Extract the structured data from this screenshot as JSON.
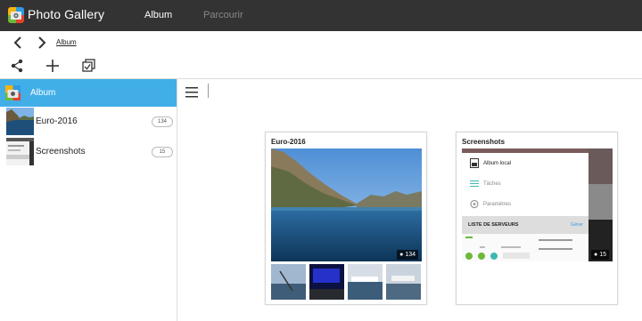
{
  "app": {
    "title": "Photo Gallery"
  },
  "nav": {
    "tab_album": "Album",
    "tab_browse": "Parcourir"
  },
  "breadcrumb": {
    "current": "Album"
  },
  "sidebar": {
    "header_label": "Album",
    "items": [
      {
        "label": "Euro-2016",
        "count": "134"
      },
      {
        "label": "Screenshots",
        "count": "15"
      }
    ]
  },
  "cards": [
    {
      "title": "Euro-2016",
      "count": "134"
    },
    {
      "title": "Screenshots",
      "count": "15",
      "preview": {
        "menu_items": [
          "Album local",
          "Tâches",
          "Paramètres"
        ],
        "server_list_label": "LISTE DE SERVEURS",
        "server_action": "Gérer"
      }
    }
  ],
  "colors": {
    "topbar": "#333333",
    "accent": "#41aee8",
    "link": "#3a9ad9"
  }
}
